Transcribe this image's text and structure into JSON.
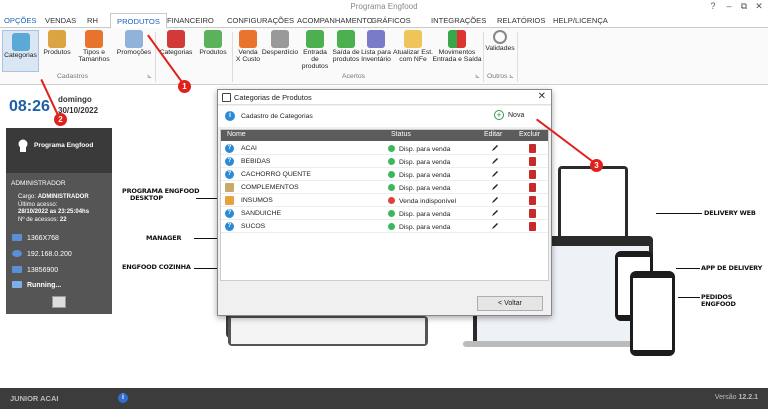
{
  "window": {
    "title": "Programa Engfood",
    "controls": [
      "?",
      "–",
      "⧉",
      "✕"
    ]
  },
  "menu": {
    "tabs": [
      "OPÇÕES",
      "VENDAS",
      "RH",
      "PRODUTOS",
      "FINANCEIRO",
      "CONFIGURAÇÕES",
      "ACOMPANHAMENTO",
      "GRÁFICOS",
      "INTEGRAÇÕES",
      "RELATÓRIOS",
      "HELP/LICENÇA"
    ],
    "active": "PRODUTOS"
  },
  "ribbon": {
    "buttons": {
      "categorias": "Categorias",
      "produtos": "Produtos",
      "tipos_l1": "Tipos e",
      "tipos_l2": "Tamanhos",
      "promocoes": "Promoções",
      "categorias2": "Categorias",
      "produtos2": "Produtos",
      "venda_l1": "Venda",
      "venda_l2": "X Custo",
      "desperdicio": "Desperdício",
      "entrada_l1": "Entrada de",
      "entrada_l2": "produtos",
      "saida_l1": "Saída de",
      "saida_l2": "produtos",
      "lista_l1": "Lista para",
      "lista_l2": "Inventário",
      "atualizar_l1": "Atualizar Est.",
      "atualizar_l2": "com NFe",
      "movimentos_l1": "Movimentos",
      "movimentos_l2": "Entrada e Saída",
      "validades": "Validades"
    },
    "groups": {
      "cadastros": "Cadastros",
      "acertos": "Acertos",
      "outros": "Outros"
    }
  },
  "left": {
    "time": "08:26",
    "weekday": "domingo",
    "date": "30/10/2022",
    "program_name": "Programa Engfood",
    "user_role": "ADMINISTRADOR",
    "cargo_label": "Cargo:",
    "cargo_value": "ADMINISTRADOR",
    "ultimo_acesso_label": "Último acesso:",
    "ultimo_acesso_value": "28/10/2022 as 23:25:04hs",
    "num_acessos_label": "Nº de acessos:",
    "num_acessos_value": "22",
    "resolution": "1366X768",
    "ip": "192.168.0.200",
    "serial": "13856900",
    "status": "Running..."
  },
  "desktop_labels": {
    "programa_l1": "PROGRAMA ENGFOOD",
    "programa_l2": "DESKTOP",
    "manager": "MANAGER",
    "cozinha": "ENGFOOD COZINHA",
    "delivery_web": "DELIVERY WEB",
    "app_delivery": "APP DE DELIVERY",
    "pedidos": "PEDIDOS ENGFOOD"
  },
  "dialog": {
    "title": "Categorias de Produtos",
    "subtitle": "Cadastro de Categorias",
    "new_label": "Nova",
    "columns": {
      "nome": "Nome",
      "status": "Status",
      "editar": "Editar",
      "excluir": "Excluir"
    },
    "rows": [
      {
        "name": "ACAI",
        "status": "Disp. para venda"
      },
      {
        "name": "BEBIDAS",
        "status": "Disp. para venda"
      },
      {
        "name": "CACHORRO QUENTE",
        "status": "Disp. para venda"
      },
      {
        "name": "COMPLEMENTOS",
        "status": "Disp. para venda"
      },
      {
        "name": "INSUMOS",
        "status": "Venda indisponível"
      },
      {
        "name": "SANDUICHE",
        "status": "Disp. para venda"
      },
      {
        "name": "SUCOS",
        "status": "Disp. para venda"
      }
    ],
    "back_label": "< Voltar"
  },
  "statusbar": {
    "company": "JUNIOR ACAI",
    "version_label": "Versão",
    "version": "12.2.1"
  },
  "annotations": [
    "1",
    "2",
    "3"
  ],
  "colors": {
    "accent": "#1b62b8",
    "available": "#3cb85c",
    "unavailable": "#e0413b",
    "delete": "#c62a2a",
    "annotation": "#e0201d"
  }
}
